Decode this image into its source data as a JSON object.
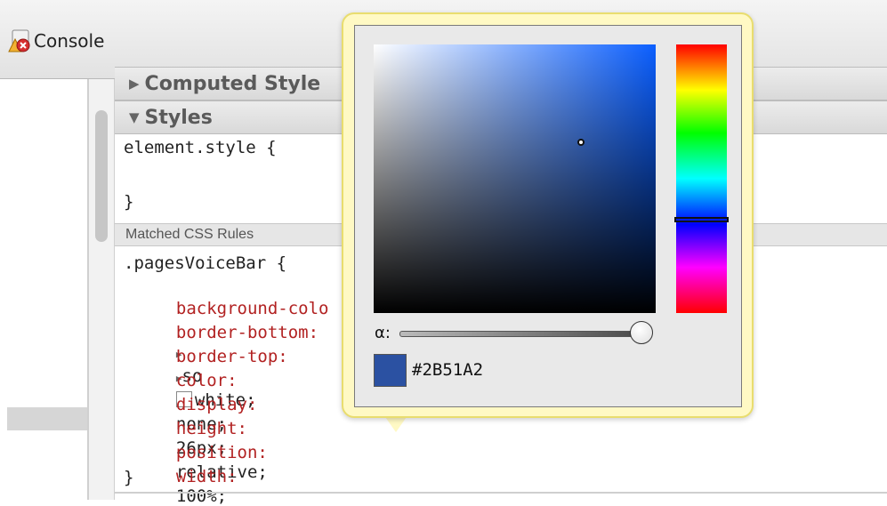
{
  "toolbar": {
    "console_label": "Console"
  },
  "sections": {
    "computed_style": "Computed Style",
    "styles": "Styles",
    "matched_rules": "Matched CSS Rules"
  },
  "element_style": {
    "open": "element.style {",
    "close": "}"
  },
  "rule": {
    "selector_open": ".pagesVoiceBar {",
    "close": "}",
    "properties": [
      {
        "name": "background-colo",
        "value": ""
      },
      {
        "name": "border-bottom:",
        "value": ""
      },
      {
        "name": "border-top:",
        "value": "so"
      },
      {
        "name": "color:",
        "value": "white;"
      },
      {
        "name": "display:",
        "value": "none;"
      },
      {
        "name": "height:",
        "value": "26px;"
      },
      {
        "name": "position:",
        "value": "relative;"
      },
      {
        "name": "width:",
        "value": "100%;"
      }
    ]
  },
  "color_picker": {
    "alpha_label": "α:",
    "hex": "#2B51A2",
    "swatch_color": "#2B51A2",
    "hue_color": "#0b5fff",
    "alpha": 1.0
  }
}
